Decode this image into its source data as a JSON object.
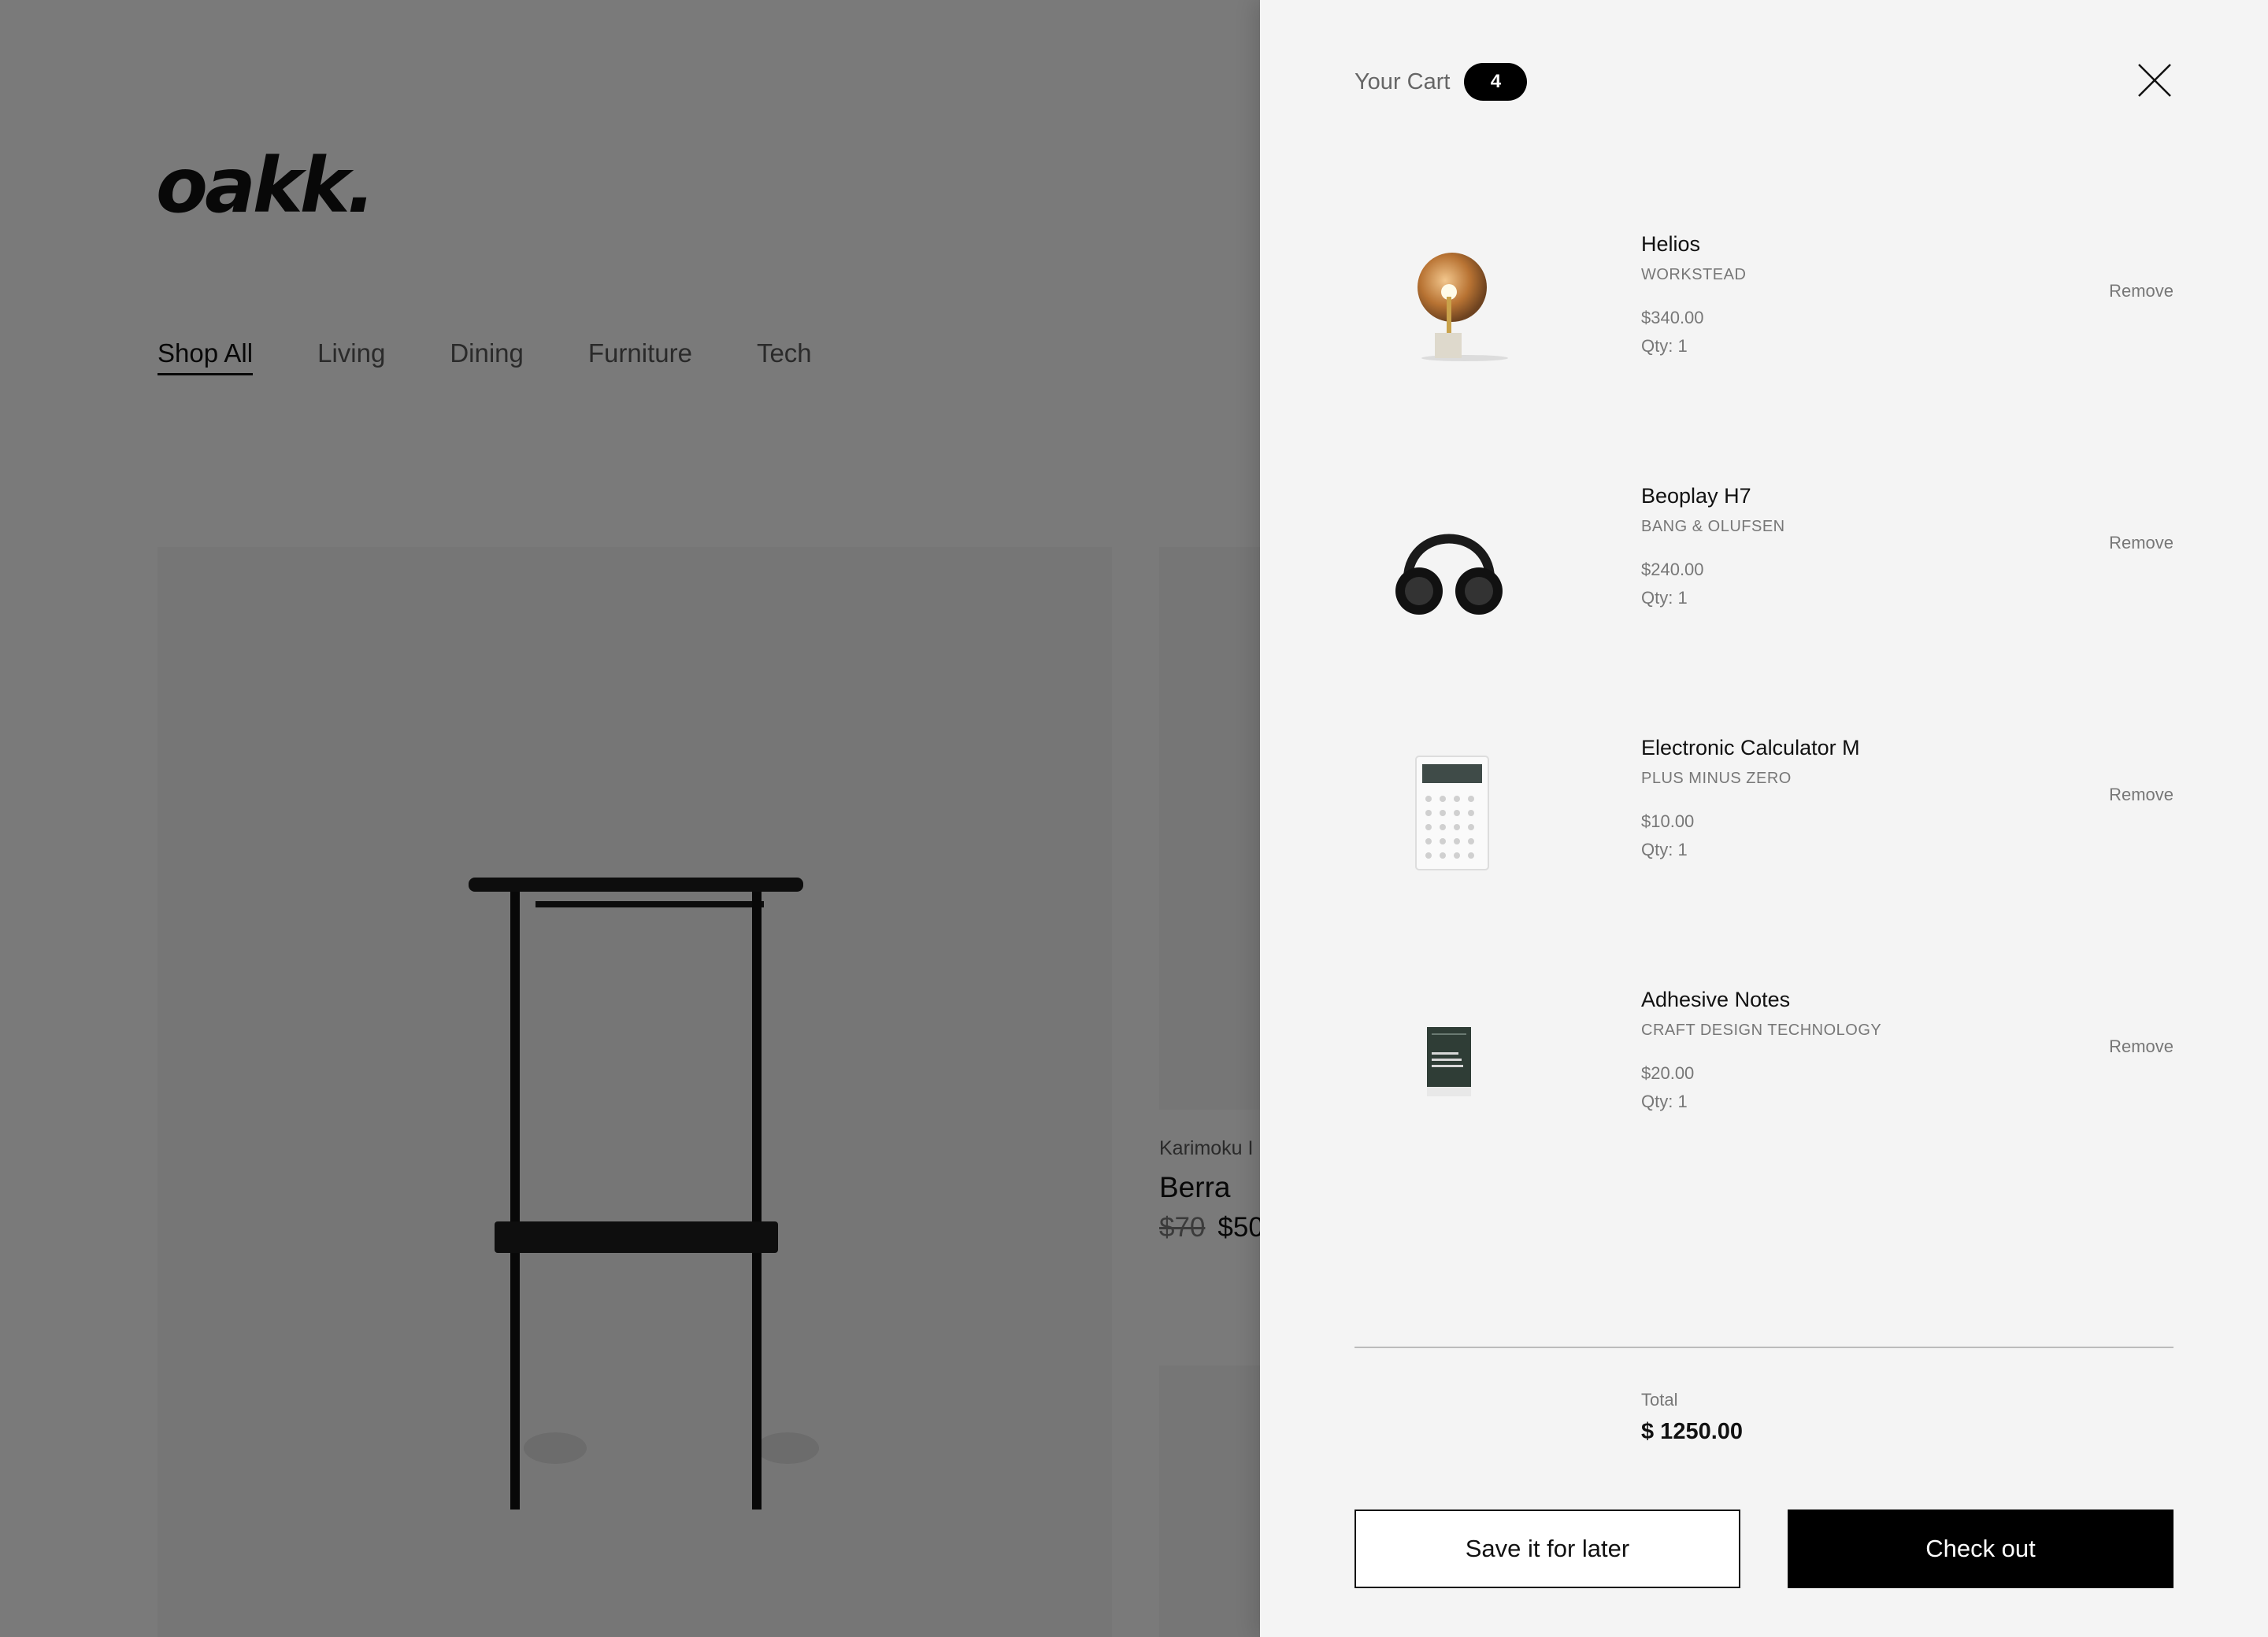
{
  "background": {
    "logo": "oakk.",
    "nav": [
      "Shop All",
      "Living",
      "Dining",
      "Furniture",
      "Tech"
    ],
    "product2": {
      "brand": "Karimoku I",
      "name": "Berra",
      "old_price": "$70",
      "price": "$50"
    }
  },
  "cart": {
    "title": "Your Cart",
    "count": "4",
    "remove_label": "Remove",
    "items": [
      {
        "name": "Helios",
        "brand": "WORKSTEAD",
        "price": "$340.00",
        "qty": "Qty: 1",
        "icon": "lamp-image"
      },
      {
        "name": "Beoplay H7",
        "brand": "BANG & OLUFSEN",
        "price": "$240.00",
        "qty": "Qty: 1",
        "icon": "headphones-image"
      },
      {
        "name": "Electronic Calculator M",
        "brand": "PLUS MINUS ZERO",
        "price": "$10.00",
        "qty": "Qty: 1",
        "icon": "calculator-image"
      },
      {
        "name": "Adhesive Notes",
        "brand": "CRAFT DESIGN TECHNOLOGY",
        "price": "$20.00",
        "qty": "Qty: 1",
        "icon": "notes-image"
      }
    ],
    "total_label": "Total",
    "total_value": "$ 1250.00",
    "save_label": "Save it for later",
    "checkout_label": "Check out"
  }
}
